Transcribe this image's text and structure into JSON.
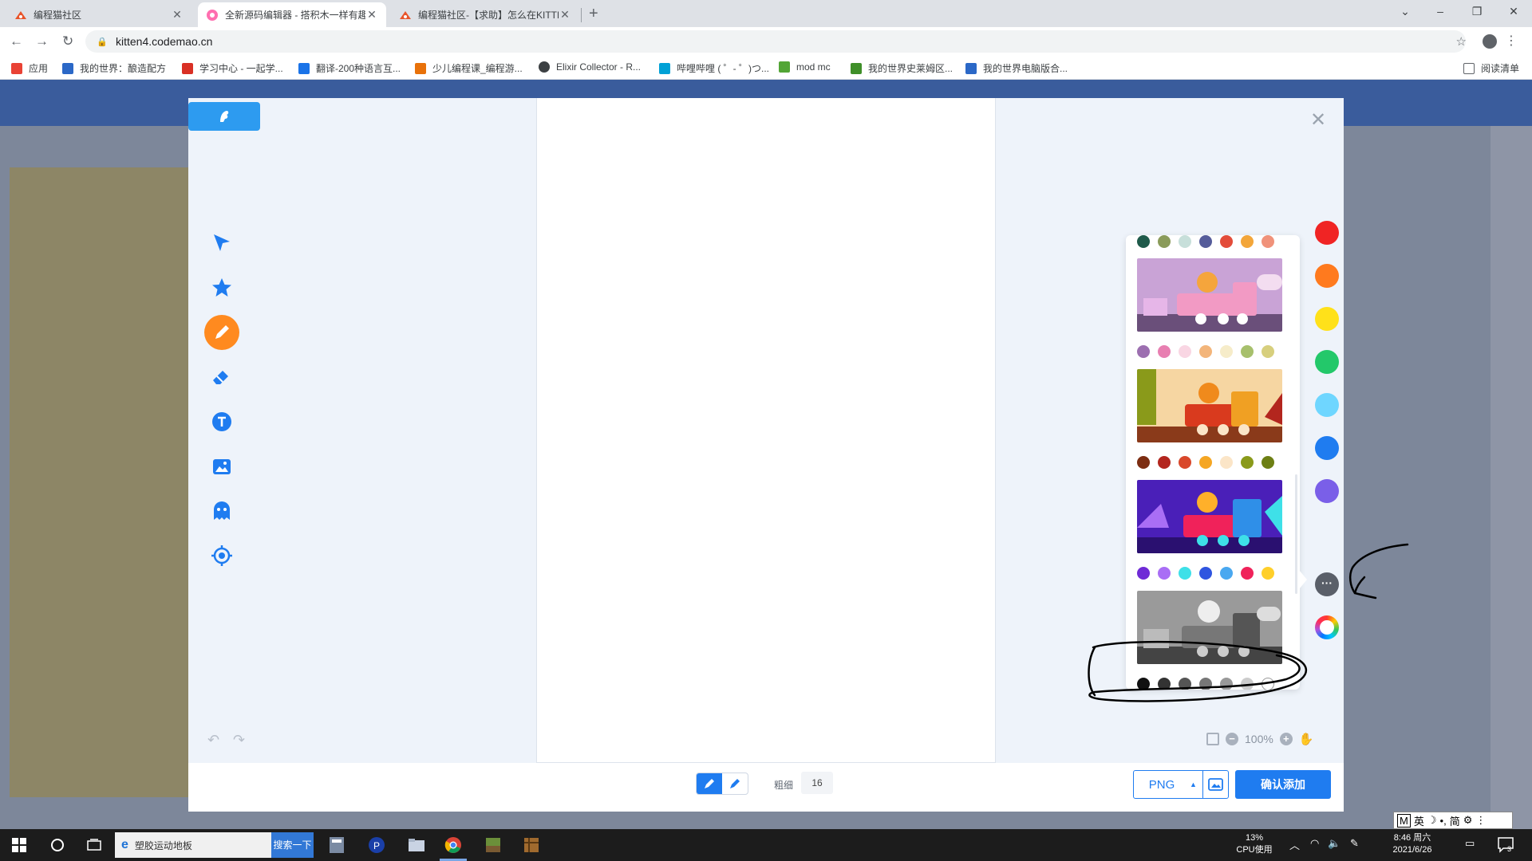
{
  "browser": {
    "tabs": [
      {
        "title": "编程猫社区",
        "active": false
      },
      {
        "title": "全新源码编辑器 - 搭积木一样有趣",
        "active": true
      },
      {
        "title": "编程猫社区-【求助】怎么在KITTEN",
        "active": false
      }
    ],
    "new_tab": "+",
    "window_controls": {
      "minimize": "–",
      "restore": "❐",
      "close": "✕"
    },
    "url": "kitten4.codemao.cn",
    "bookmarks": [
      {
        "label": "应用",
        "color": "#e94235"
      },
      {
        "label": "我的世界：酿造配方",
        "color": "#2b68c7"
      },
      {
        "label": "学习中心 - 一起学...",
        "color": "#d93025"
      },
      {
        "label": "翻译-200种语言互...",
        "color": "#1a73e8"
      },
      {
        "label": "少儿编程课_编程游...",
        "color": "#e8710a"
      },
      {
        "label": "Elixir Collector - R...",
        "color": "#3c4043"
      },
      {
        "label": "哔哩哔哩 ( ゜- ゜)つ...",
        "color": "#00a1d6"
      },
      {
        "label": "mod mc",
        "color": "#52a535"
      },
      {
        "label": "我的世界史莱姆区...",
        "color": "#3f8f29"
      },
      {
        "label": "我的世界电脑版合...",
        "color": "#2b68c7"
      }
    ],
    "reading_list": "阅读清单"
  },
  "editor": {
    "tools": [
      {
        "name": "select-tool",
        "icon": "cursor-arrow-icon"
      },
      {
        "name": "shape-tool",
        "icon": "star-icon"
      },
      {
        "name": "brush-tool",
        "icon": "brush-icon",
        "active": true
      },
      {
        "name": "eraser-tool",
        "icon": "eraser-icon"
      },
      {
        "name": "text-tool",
        "icon": "text-icon"
      },
      {
        "name": "image-tool",
        "icon": "image-icon"
      },
      {
        "name": "character-tool",
        "icon": "ghost-icon"
      },
      {
        "name": "target-tool",
        "icon": "target-icon"
      }
    ],
    "undo": "↶",
    "redo": "↷",
    "close": "✕",
    "palette": {
      "top_row": [
        "#1f5a4a",
        "#8a9b5a",
        "#c7dfda",
        "#555c9a",
        "#e34c3a",
        "#f3a63a",
        "#f0927a"
      ],
      "themes": [
        {
          "name": "pink-train",
          "bg": "#c9a3d6",
          "swatches": [
            "#9c6fb0",
            "#e87fb1",
            "#f9d6e3",
            "#f3b57a",
            "#f6ecc9",
            "#a7c06c",
            "#d7cf7d"
          ]
        },
        {
          "name": "orange-train",
          "bg": "#f5c27c",
          "swatches": [
            "#7c2d12",
            "#b3261e",
            "#d9482b",
            "#f5a623",
            "#fbe5c7",
            "#8a9a1a",
            "#6d7f14"
          ]
        },
        {
          "name": "purple-train",
          "bg": "#5b2bd6",
          "swatches": [
            "#6f2ad6",
            "#a96ef5",
            "#3ee0e8",
            "#2f55e0",
            "#49a8f0",
            "#f0225a",
            "#ffcf2a"
          ]
        },
        {
          "name": "gray-train",
          "bg": "#9a9a9a",
          "swatches": [
            "#111111",
            "#333333",
            "#555555",
            "#777777",
            "#999999",
            "#cccccc",
            "#ffffff"
          ]
        }
      ]
    },
    "quick_colors": [
      "#f02424",
      "#ff7a1e",
      "#ffe11a",
      "#23c86a",
      "#6fd6ff",
      "#1f7cf0",
      "#7a5fe8"
    ],
    "more_colors": "···",
    "zoom": "100%",
    "bottom": {
      "thickness_label": "粗细",
      "thickness_value": "16",
      "format": "PNG",
      "confirm": "确认添加"
    }
  },
  "ime": {
    "mode": "M",
    "lang": "英",
    "moon": "☽",
    "dot": "•,",
    "simp": "简",
    "gear": "⚙",
    "arrow": "⋮"
  },
  "taskbar": {
    "search_text": "塑胶运动地板",
    "search_button": "搜索一下",
    "cpu_value": "13%",
    "cpu_label": "CPU使用",
    "time": "8:46 周六",
    "date": "2021/6/26",
    "notifications": "3"
  }
}
